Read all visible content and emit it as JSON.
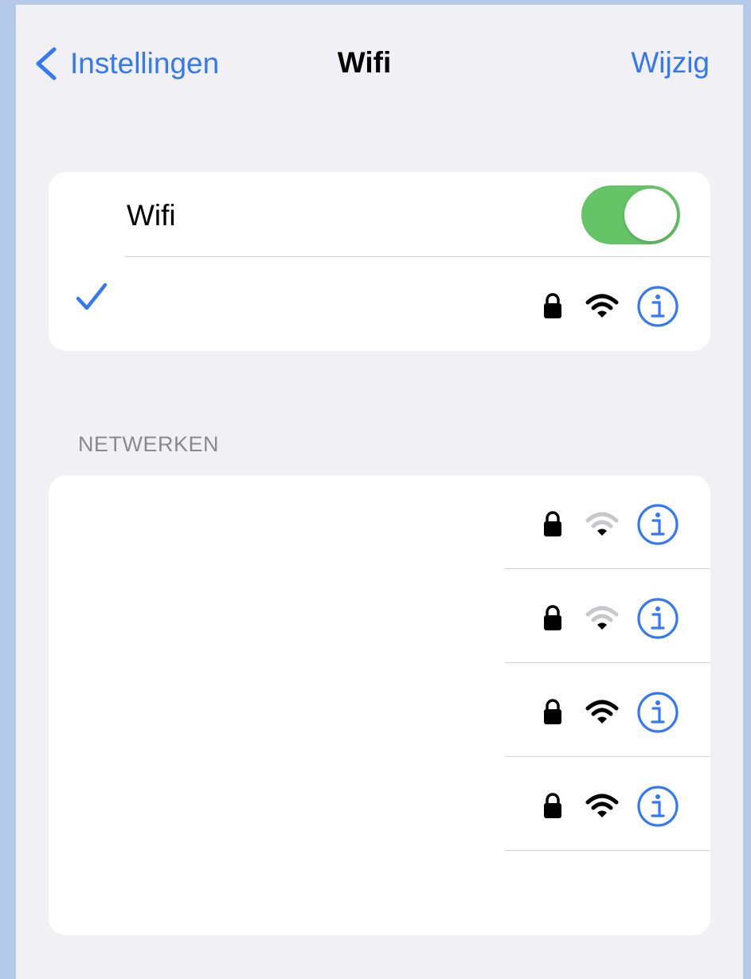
{
  "nav": {
    "back_label": "Instellingen",
    "title": "Wifi",
    "edit_label": "Wijzig"
  },
  "wifi_toggle": {
    "label": "Wifi",
    "enabled": true
  },
  "connected_network": {
    "name": "",
    "secured": true,
    "signal": "full",
    "selected": true
  },
  "networks_section": {
    "header": "NETWERKEN",
    "items": [
      {
        "name": "",
        "secured": true,
        "signal": "weak"
      },
      {
        "name": "",
        "secured": true,
        "signal": "weak"
      },
      {
        "name": "",
        "secured": true,
        "signal": "full"
      },
      {
        "name": "",
        "secured": true,
        "signal": "full"
      }
    ]
  },
  "colors": {
    "accent": "#3478f6",
    "toggle_on": "#65c466",
    "background": "#f0f0f5",
    "separator": "#d1d1d6",
    "weak_signal": "#c7c7cc"
  },
  "icons": [
    "chevron-left-icon",
    "checkmark-icon",
    "lock-icon",
    "wifi-icon",
    "info-icon"
  ]
}
